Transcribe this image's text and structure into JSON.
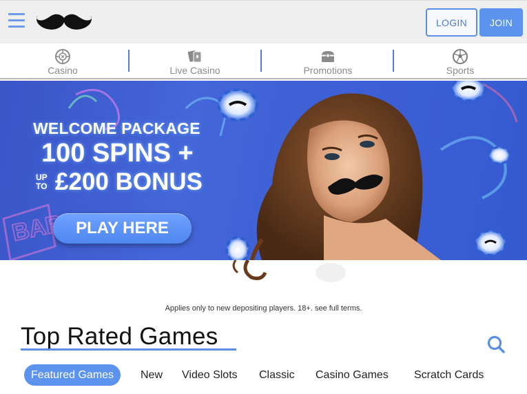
{
  "header": {
    "menu_icon": "hamburger-menu-icon",
    "logo_icon": "moustache-logo",
    "login_label": "LOGIN",
    "join_label": "JOIN",
    "accent_color": "#5b93ee"
  },
  "nav": {
    "items": [
      {
        "label": "Casino",
        "icon": "roulette-wheel-icon"
      },
      {
        "label": "Live Casino",
        "icon": "playing-cards-icon"
      },
      {
        "label": "Promotions",
        "icon": "treasure-chest-icon"
      },
      {
        "label": "Sports",
        "icon": "soccer-ball-icon"
      }
    ]
  },
  "banner": {
    "line1": "WELCOME PACKAGE",
    "line2": "100 SPINS +",
    "up": "UP",
    "to": "TO",
    "line3": "£200 BONUS",
    "cta": "PLAY HERE"
  },
  "terms": "Applies only to new depositing players. 18+. see full terms.",
  "games": {
    "title": "Top Rated Games",
    "search_icon": "search-icon",
    "tabs": [
      "Featured Games",
      "New",
      "Video Slots",
      "Classic",
      "Casino Games",
      "Scratch Cards"
    ],
    "active_tab": "Featured Games"
  }
}
